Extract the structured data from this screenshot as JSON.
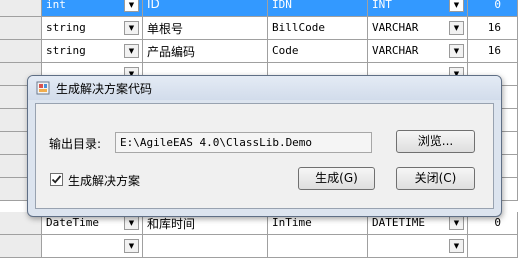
{
  "grid": {
    "rows": [
      {
        "type": "int",
        "name": "ID",
        "column": "IDN",
        "db_type": "INT",
        "value": "0",
        "selected": true
      },
      {
        "type": "string",
        "name": "单根号",
        "column": "BillCode",
        "db_type": "VARCHAR",
        "value": "16",
        "selected": false
      },
      {
        "type": "string",
        "name": "产品编码",
        "column": "Code",
        "db_type": "VARCHAR",
        "value": "16",
        "selected": false
      },
      {
        "type": "",
        "name": "",
        "column": "",
        "db_type": "",
        "value": "",
        "selected": false
      },
      {
        "type": "",
        "name": "",
        "column": "",
        "db_type": "",
        "value": "",
        "selected": false
      },
      {
        "type": "",
        "name": "",
        "column": "",
        "db_type": "",
        "value": "",
        "selected": false
      },
      {
        "type": "",
        "name": "",
        "column": "",
        "db_type": "",
        "value": "",
        "selected": false
      },
      {
        "type": "",
        "name": "",
        "column": "",
        "db_type": "",
        "value": "",
        "selected": false
      },
      {
        "type": "",
        "name": "",
        "column": "",
        "db_type": "",
        "value": "",
        "selected": false
      },
      {
        "type": "DateTime",
        "name": "和库时间",
        "column": "InTime",
        "db_type": "DATETIME",
        "value": "0",
        "selected": false
      },
      {
        "type": "",
        "name": "",
        "column": "",
        "db_type": "",
        "value": "",
        "selected": false
      }
    ],
    "dropdown_glyph": "▼"
  },
  "dialog": {
    "title": "生成解决方案代码",
    "output_dir_label": "输出目录:",
    "output_dir_value": "E:\\AgileEAS 4.0\\ClassLib.Demo",
    "browse_label": "浏览...",
    "checkbox_label": "生成解决方案",
    "checkbox_checked": true,
    "checkmark": "✓",
    "generate_label": "生成(G)",
    "close_label": "关闭(C)"
  },
  "colors": {
    "selection": "#3399ff",
    "dialog_frame": "#dce4ef"
  }
}
